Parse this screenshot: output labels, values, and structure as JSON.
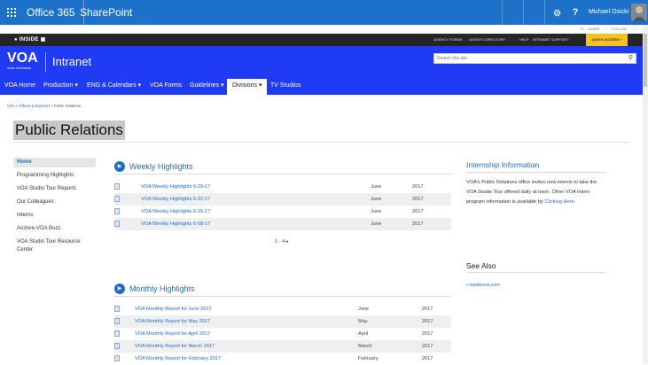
{
  "suite_bar": {
    "app_name": "Office 365",
    "site_app": "SharePoint",
    "user_name": "Michael Osicki"
  },
  "actions": {
    "share": "SHARE",
    "follow": "FOLLOW"
  },
  "inside_bar": {
    "logo": "INSIDE",
    "links": [
      "AGENCY FORMS",
      "AGENCY DIRECTORY",
      "HELP",
      "INTRANET SUPPORT"
    ],
    "quick_access": "QUICK ACCESS"
  },
  "header": {
    "logo_mark": "VOA",
    "logo_sub": "Voice of America",
    "site_title": "Intranet",
    "search_placeholder": "Search this site"
  },
  "nav": {
    "items": [
      "VOA Home",
      "Production",
      "ENG & Calendars",
      "VOA Forms",
      "Guidelines",
      "Divisions",
      "TV Studios"
    ]
  },
  "breadcrumb": {
    "home": "VOA",
    "sep1": ">",
    "offices": "Offices & Divisions",
    "sep2": ">",
    "current": "Public Relations"
  },
  "page_title": "Public Relations",
  "left_nav": [
    "Home",
    "Programming Highlights",
    "VOA Studio Tour Reports",
    "Our Colleagues",
    "Interns",
    "Archive-VOA Buzz",
    "VOA Studio Tour Resource Center"
  ],
  "weekly": {
    "title": "Weekly Highlights",
    "rows": [
      {
        "title": "VOA Weekly Highlights 6-29-17",
        "month": "June",
        "year": "2017"
      },
      {
        "title": "VOA Weekly Highlights 6-22-17",
        "month": "June",
        "year": "2017"
      },
      {
        "title": "VOA Weekly Highlights 6-15-17",
        "month": "June",
        "year": "2017"
      },
      {
        "title": "VOA Weekly Highlights 6-08-17",
        "month": "June",
        "year": "2017"
      }
    ],
    "pager": "1 - 4"
  },
  "monthly": {
    "title": "Monthly Highlights",
    "rows": [
      {
        "title": "VOA Monthly Report for June 2017",
        "month": "June",
        "year": "2017"
      },
      {
        "title": "VOA Monthly Report for May 2017",
        "month": "May",
        "year": "2017"
      },
      {
        "title": "VOA Monthly Report for April 2017",
        "month": "April",
        "year": "2017"
      },
      {
        "title": "VOA Monthly Report for March 2017",
        "month": "March",
        "year": "2017"
      },
      {
        "title": "VOA Monthly Report for February 2017",
        "month": "February",
        "year": "2017"
      }
    ]
  },
  "internship": {
    "title": "Internship Information",
    "text": "VOA's Public Relations office invites new interns to take the VOA Studio Tour offered daily at noon. Other VOA intern program information is available by",
    "link": "Clicking Here",
    "end": "."
  },
  "see_also": {
    "title": "See Also",
    "link": "insidevoa.com"
  },
  "icons": [
    "waffle-icon",
    "gear-icon",
    "help-icon",
    "search-icon",
    "document-icon",
    "webpart-icon",
    "chevron-down-icon"
  ],
  "colors": {
    "suite": "#1d71c9",
    "header": "#1f3cf4",
    "link": "#1f6cc4",
    "quick_access": "#f7c21e"
  }
}
